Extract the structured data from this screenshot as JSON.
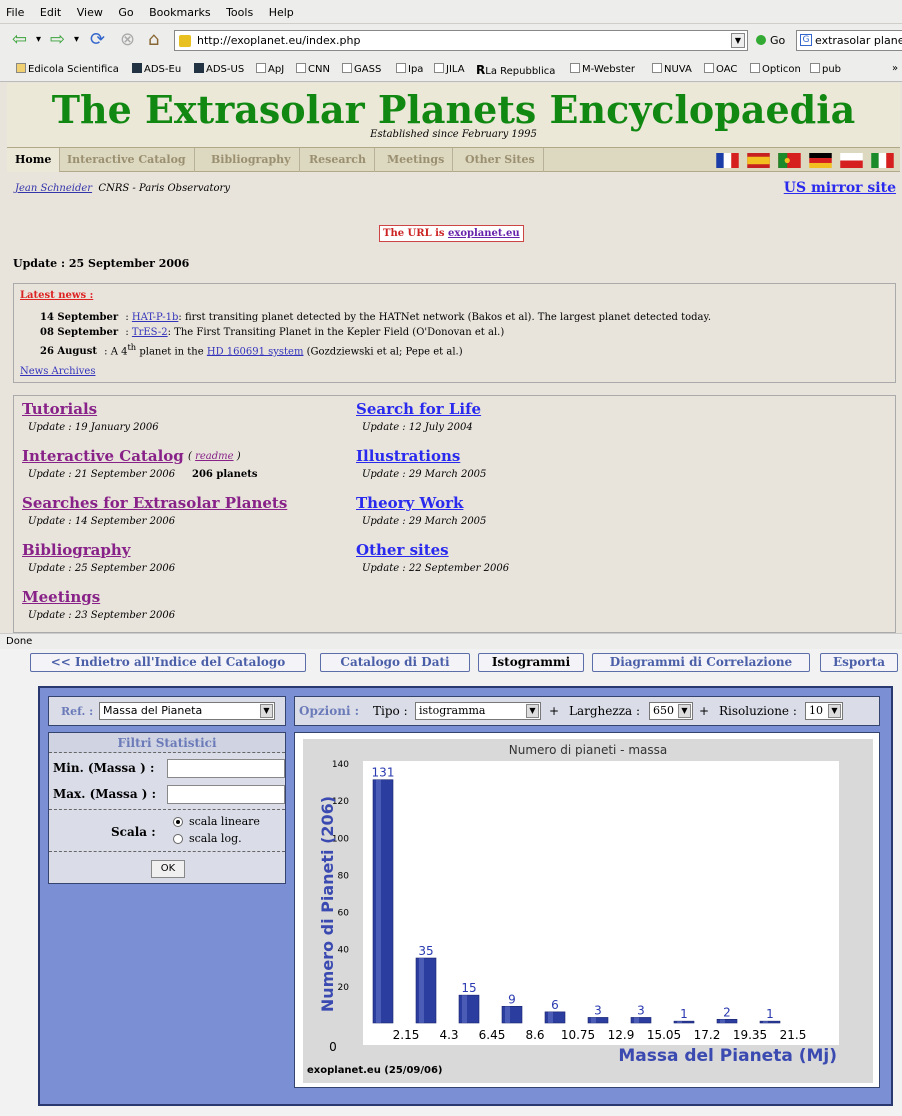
{
  "browser": {
    "menu": [
      "File",
      "Edit",
      "View",
      "Go",
      "Bookmarks",
      "Tools",
      "Help"
    ],
    "url": "http://exoplanet.eu/index.php",
    "go_label": "Go",
    "search_text": "extrasolar planets",
    "bookmarks": [
      "Edicola Scientifica",
      "ADS-Eu",
      "ADS-US",
      "ApJ",
      "CNN",
      "GASS",
      "Ipa",
      "JILA",
      "La Repubblica",
      "M-Webster",
      "NUVA",
      "OAC",
      "Opticon",
      "pub"
    ],
    "status": "Done"
  },
  "site": {
    "title": "The Extrasolar Planets Encyclopaedia",
    "established": "Established since February 1995",
    "tabs": [
      "Home",
      "Interactive Catalog",
      "Bibliography",
      "Research",
      "Meetings",
      "Other Sites"
    ],
    "author_link": "Jean Schneider",
    "author_affil": "CNRS - Paris Observatory",
    "mirror": "US mirror site",
    "url_note_prefix": "The URL is",
    "url_note_link": "exoplanet.eu",
    "update": "Update : 25 September 2006",
    "news_head": "Latest news :",
    "news": [
      {
        "date": "14 September",
        "link": "HAT-P-1b",
        "text": ": first transiting planet detected by the HATNet network (Bakos et al). The largest planet detected today."
      },
      {
        "date": "08 September",
        "link": "TrES-2",
        "text": ": The First Transiting Planet in the Kepler Field (O'Donovan et al.)"
      },
      {
        "date": "26 August",
        "pre": "A 4",
        "sup": "th",
        "mid": " planet in the ",
        "link": "HD 160691 system",
        "text": " (Gozdziewski et al; Pepe et al.)"
      }
    ],
    "archives": "News Archives",
    "left_links": [
      {
        "label": "Tutorials",
        "update": "Update : 19 January 2006"
      },
      {
        "label": "Interactive Catalog",
        "update": "Update : 21 September 2006",
        "readme": "readme",
        "count": "206 planets"
      },
      {
        "label": "Searches for Extrasolar Planets",
        "update": "Update : 14 September 2006"
      },
      {
        "label": "Bibliography",
        "update": "Update : 25 September 2006"
      },
      {
        "label": "Meetings",
        "update": "Update : 23 September 2006"
      }
    ],
    "right_links": [
      {
        "label": "Search for Life",
        "update": "Update : 12 July 2004"
      },
      {
        "label": "Illustrations",
        "update": "Update : 29 March 2005"
      },
      {
        "label": "Theory Work",
        "update": "Update : 29 March 2005"
      },
      {
        "label": "Other sites",
        "update": "Update : 22 September 2006"
      }
    ]
  },
  "catalog": {
    "buttons": [
      "<< Indietro all'Indice del Catalogo",
      "Catalogo di Dati",
      "Istogrammi",
      "Diagrammi di Correlazione",
      "Esporta"
    ],
    "ref_label": "Ref. :",
    "ref_value": "Massa del Pianeta",
    "options_label": "Opzioni :",
    "tipo_label": "Tipo :",
    "tipo_value": "istogramma",
    "plus": "+",
    "larghezza_label": "Larghezza :",
    "larghezza_value": "650",
    "risoluzione_label": "Risoluzione :",
    "risoluzione_value": "10",
    "filter_title": "Filtri Statistici",
    "min_label": "Min. (Massa ) :",
    "max_label": "Max. (Massa ) :",
    "scala_label": "Scala :",
    "scala_options": [
      "scala lineare",
      "scala log."
    ],
    "ok_label": "OK"
  },
  "chart_data": {
    "type": "bar",
    "title": "Numero di pianeti - massa",
    "xlabel": "Massa del Pianeta (Mj)",
    "ylabel": "Numero di Pianeti (206)",
    "credit": "exoplanet.eu (25/09/06)",
    "x_ticks": [
      "0",
      "2.15",
      "4.3",
      "6.45",
      "8.6",
      "10.75",
      "12.9",
      "15.05",
      "17.2",
      "19.35",
      "21.5"
    ],
    "y_ticks": [
      20,
      40,
      60,
      80,
      100,
      120,
      140
    ],
    "values": [
      131,
      35,
      15,
      9,
      6,
      3,
      3,
      1,
      2,
      1
    ],
    "ylim": [
      0,
      140
    ],
    "bar_color": "#2b3d9e"
  }
}
